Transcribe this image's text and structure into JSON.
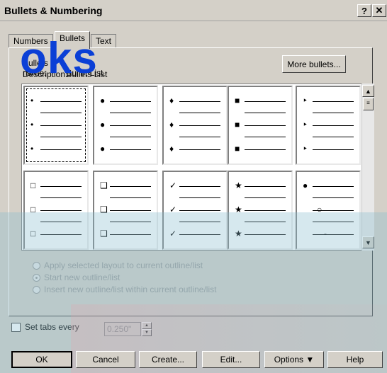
{
  "window": {
    "title": "Bullets & Numbering",
    "help_label": "?",
    "close_label": "✕"
  },
  "watermark": "oks",
  "tabs": [
    {
      "label": "Numbers",
      "active": false
    },
    {
      "label": "Bullets",
      "active": true
    },
    {
      "label": "Text",
      "active": false
    }
  ],
  "info": {
    "name_label": "Bullets name:",
    "name_value": "Bullet List",
    "desc_label": "Description:",
    "desc_value": "Bullets List"
  },
  "more_bullets_label": "More bullets...",
  "bullet_grid": [
    {
      "row": 1,
      "col": 1,
      "symbol": "•",
      "selected": true
    },
    {
      "row": 1,
      "col": 2,
      "symbol": "●",
      "selected": false
    },
    {
      "row": 1,
      "col": 3,
      "symbol": "♦",
      "selected": false
    },
    {
      "row": 1,
      "col": 4,
      "symbol": "■",
      "selected": false
    },
    {
      "row": 1,
      "col": 5,
      "symbol": "‣",
      "selected": false
    },
    {
      "row": 2,
      "col": 1,
      "symbol": "□",
      "selected": false
    },
    {
      "row": 2,
      "col": 2,
      "symbol": "❑",
      "selected": false
    },
    {
      "row": 2,
      "col": 3,
      "symbol": "✓",
      "selected": false
    },
    {
      "row": 2,
      "col": 4,
      "symbol": "★",
      "selected": false
    },
    {
      "row": 2,
      "col": 5,
      "symbol": "●",
      "mixed": [
        "●",
        "○",
        "-"
      ],
      "selected": false
    }
  ],
  "scroll": {
    "up_icon": "▲",
    "down_icon": "▼",
    "thumb": "≡"
  },
  "radio_options": [
    {
      "label": "Apply selected layout to current outline/list",
      "checked": false
    },
    {
      "label": "Start new outline/list",
      "checked": true
    },
    {
      "label": "Insert new outline/list within current outline/list",
      "checked": false
    }
  ],
  "set_tabs": {
    "label": "Set tabs every",
    "checked": false,
    "value": "0.250\""
  },
  "buttons": {
    "ok": "OK",
    "cancel": "Cancel",
    "create": "Create...",
    "edit": "Edit...",
    "options": "Options ▼",
    "help": "Help"
  }
}
